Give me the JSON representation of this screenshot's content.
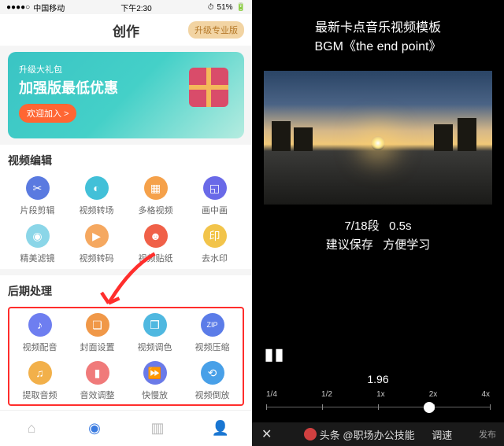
{
  "status": {
    "carrier": "中国移动",
    "signal": "●●●●○",
    "time": "下午2:30",
    "alarm": "⏱",
    "battery": "51%",
    "battery_icon": "🔋"
  },
  "header": {
    "title": "创作",
    "upgrade": "升级专业版"
  },
  "promo": {
    "subtitle": "升级大礼包",
    "title": "加强版最低优惠",
    "button": "欢迎加入 >"
  },
  "section_edit": {
    "title": "视频编辑",
    "items": [
      {
        "label": "片段剪辑",
        "bg": "#5a7ae0",
        "glyph": "✂"
      },
      {
        "label": "视频转场",
        "bg": "#42c0d8",
        "glyph": "◐"
      },
      {
        "label": "多格视频",
        "bg": "#f5a14a",
        "glyph": "▦"
      },
      {
        "label": "画中画",
        "bg": "#6a6ae8",
        "glyph": "◱"
      },
      {
        "label": "精美滤镜",
        "bg": "#8bd6e8",
        "glyph": "◉"
      },
      {
        "label": "视频转码",
        "bg": "#f5a860",
        "glyph": "▶"
      },
      {
        "label": "视频贴纸",
        "bg": "#f06048",
        "glyph": "☻"
      },
      {
        "label": "去水印",
        "bg": "#f2c44a",
        "glyph": "印"
      }
    ]
  },
  "section_post": {
    "title": "后期处理",
    "items": [
      {
        "label": "视频配音",
        "bg": "#6e7ef0",
        "glyph": "♪"
      },
      {
        "label": "封面设置",
        "bg": "#f09848",
        "glyph": "❏"
      },
      {
        "label": "视频调色",
        "bg": "#4fb8e0",
        "glyph": "❒"
      },
      {
        "label": "视频压缩",
        "bg": "#5b7ce8",
        "glyph": "ZIP"
      },
      {
        "label": "提取音频",
        "bg": "#f2b04a",
        "glyph": "♫"
      },
      {
        "label": "音效调整",
        "bg": "#f07a7a",
        "glyph": "▮"
      },
      {
        "label": "快慢放",
        "bg": "#6a7ae8",
        "glyph": "⏩"
      },
      {
        "label": "视频倒放",
        "bg": "#48a0e8",
        "glyph": "⟲"
      }
    ]
  },
  "right": {
    "title_line1": "最新卡点音乐视频模板",
    "title_line2": "BGM《the end point》",
    "progress": "7/18段",
    "duration": "0.5s",
    "hint1": "建议保存",
    "hint2": "方便学习",
    "speed_value": "1.96",
    "speed_marks": [
      "1/4",
      "1/2",
      "1x",
      "2x",
      "4x"
    ],
    "knob_pct": 73,
    "speed_label": "调速",
    "author_prefix": "头条",
    "author": "@职场办公技能",
    "publish": "发布"
  }
}
